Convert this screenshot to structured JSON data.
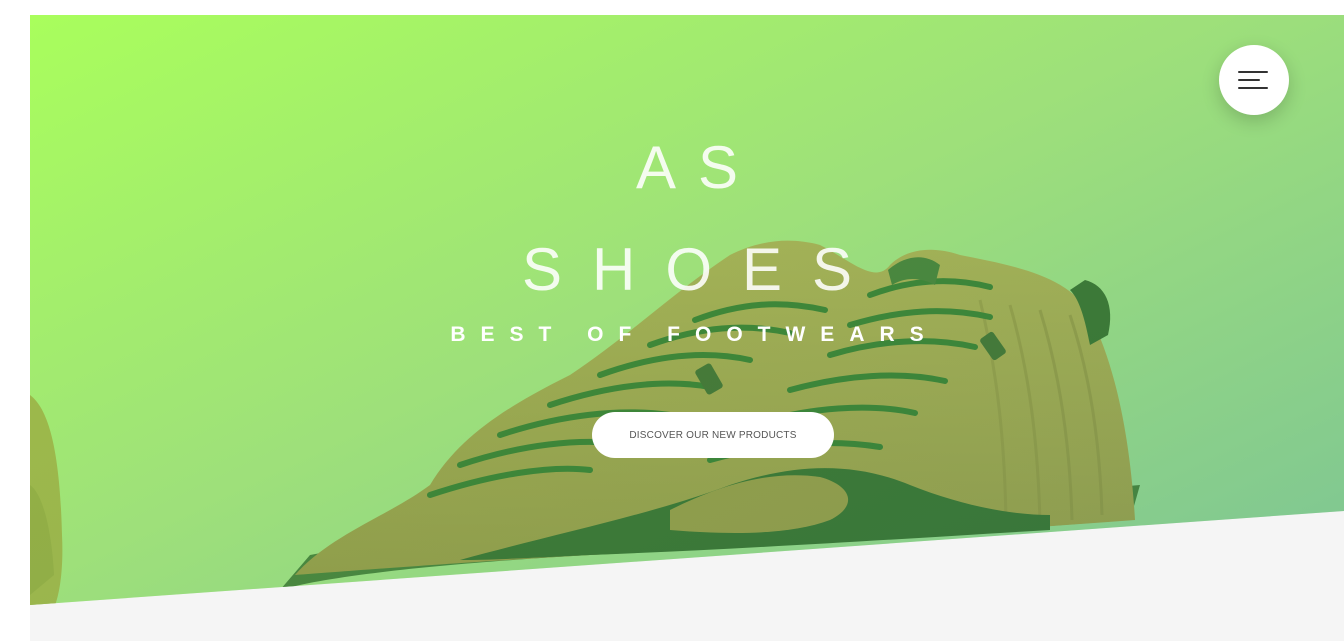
{
  "hero": {
    "title_line_1": "AS",
    "title_line_2": "SHOES",
    "tagline": "BEST OF FOOTWEARS",
    "cta_label": "DISCOVER OUR NEW PRODUCTS",
    "background_image": "shoe-photo"
  },
  "header": {
    "menu_icon": "hamburger-menu-icon"
  },
  "colors": {
    "gradient_start": "#a8ff5a",
    "gradient_end": "#7dc493",
    "lower_section": "#f5f5f5",
    "title_text": "#ffffff"
  }
}
